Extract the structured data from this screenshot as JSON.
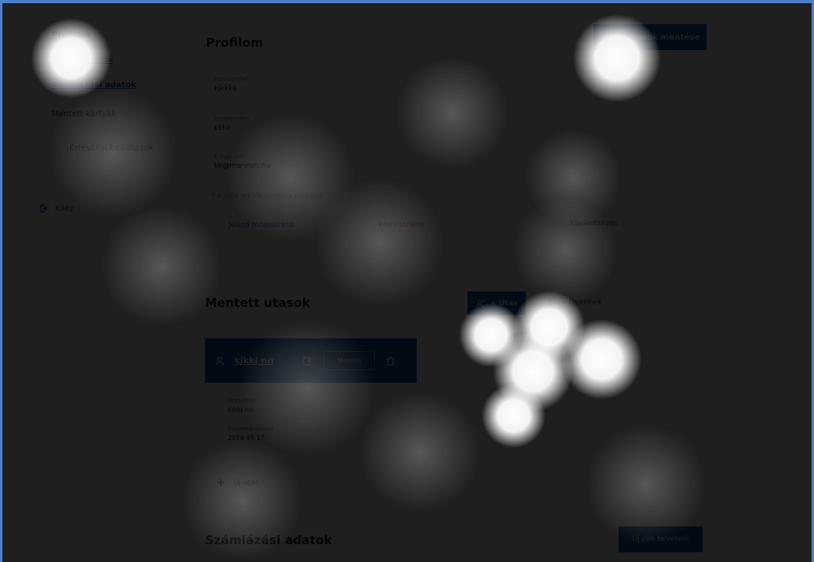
{
  "sidebar": {
    "items": [
      {
        "label": "Profilom"
      },
      {
        "label": "Mentett utasok"
      },
      {
        "label": "Számlázási adatok"
      },
      {
        "label": "Mentett kártyák"
      },
      {
        "label": "Értesítési beállítások"
      }
    ],
    "logout": {
      "label": "Kilép"
    }
  },
  "profile": {
    "title": "Profilom",
    "save_button": "Módosítások mentése",
    "fields": [
      {
        "label": "Keresztnév*",
        "value": "kjkkkk"
      },
      {
        "label": "Vezetéknév*",
        "value": "kkkk"
      },
      {
        "label": "E-mail cím*",
        "value": "kk@mannoli.hu"
      }
    ],
    "required_note": "* A jelölt mezők kitöltése kötelező",
    "password_link": "Jelszó módosítása",
    "delete_link": "Profil törlése",
    "logout_link": "Kijelentkezés"
  },
  "saved_passengers": {
    "title": "Mentett utasok",
    "add_passenger_button": "+ Utas",
    "add_child_button": "+ Gyermek",
    "card": {
      "name": "kjkkj nn",
      "edit_button": "Mentés",
      "details": [
        {
          "label": "Utas neve",
          "value": "kjkkj nn"
        },
        {
          "label": "Születési dátum",
          "value": "2014.05.17"
        }
      ]
    },
    "new_passenger_link": "Új utas"
  },
  "billing": {
    "title": "Számlázási adatok",
    "new_address_button": "Új cím felvétele"
  },
  "colors": {
    "accent": "#0a53a8",
    "danger": "#c0392b",
    "frame": "#4c7fc9"
  },
  "icons": {
    "logout": "logout-icon",
    "person": "person-icon",
    "edit": "edit-icon",
    "trash": "trash-icon",
    "add_person": "add-person-icon",
    "plus": "plus-icon"
  }
}
